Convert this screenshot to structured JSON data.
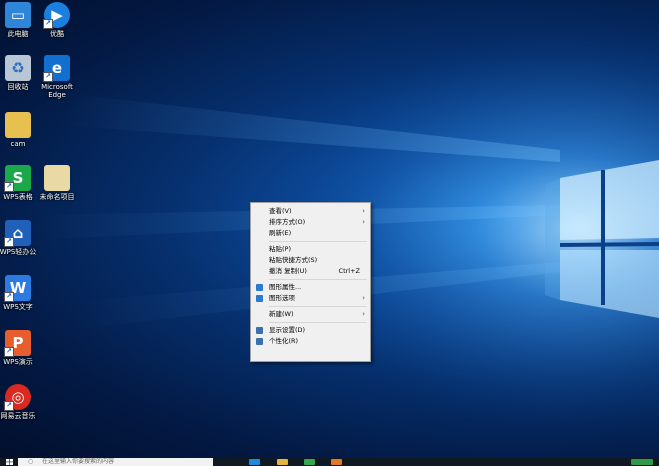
{
  "desktop": {
    "icons": [
      {
        "label": "此电脑",
        "icon": "this-pc-icon",
        "color": "#2f86d8",
        "glyph": "▭"
      },
      {
        "label": "优酷",
        "icon": "youku-icon",
        "color": "#1b7fe0",
        "glyph": "▶"
      },
      {
        "label": "回收站",
        "icon": "recycle-bin-icon",
        "color": "#b8c6d6",
        "glyph": "♻"
      },
      {
        "label": "Microsoft Edge",
        "icon": "edge-icon",
        "color": "#1170cf",
        "glyph": "e"
      },
      {
        "label": "cam",
        "icon": "folder-icon",
        "color": "#e8c050",
        "glyph": ""
      },
      {
        "label": "WPS表格",
        "icon": "wps-spreadsheet-icon",
        "color": "#1ba84a",
        "glyph": "S"
      },
      {
        "label": "未命名项目",
        "icon": "file-icon",
        "color": "#e9d9a4",
        "glyph": ""
      },
      {
        "label": "WPS轻办公",
        "icon": "wps-light-office-icon",
        "color": "#2060b8",
        "glyph": "⌂"
      },
      {
        "label": "WPS文字",
        "icon": "wps-writer-icon",
        "color": "#2d7be0",
        "glyph": "W"
      },
      {
        "label": "WPS演示",
        "icon": "wps-presentation-icon",
        "color": "#e85d2e",
        "glyph": "P"
      },
      {
        "label": "网易云音乐",
        "icon": "netease-music-icon",
        "color": "#d82a20",
        "glyph": "◎"
      }
    ]
  },
  "context_menu": {
    "items": [
      {
        "label": "查看(V)",
        "submenu": true
      },
      {
        "label": "排序方式(O)",
        "submenu": true
      },
      {
        "label": "刷新(E)"
      },
      {
        "separator": true
      },
      {
        "label": "粘贴(P)"
      },
      {
        "label": "粘贴快捷方式(S)"
      },
      {
        "label": "撤消 复制(U)",
        "shortcut": "Ctrl+Z"
      },
      {
        "separator": true
      },
      {
        "label": "图形属性...",
        "icon": "graphics-properties-icon",
        "icon_color": "#2a7bd0"
      },
      {
        "label": "图形选项",
        "icon": "graphics-options-icon",
        "icon_color": "#2a7bd0",
        "submenu": true
      },
      {
        "separator": true
      },
      {
        "label": "新建(W)",
        "submenu": true
      },
      {
        "separator": true
      },
      {
        "label": "显示设置(D)",
        "icon": "display-settings-icon",
        "icon_color": "#3a6fb0"
      },
      {
        "label": "个性化(R)",
        "icon": "personalize-icon",
        "icon_color": "#3a6fb0"
      }
    ]
  },
  "taskbar": {
    "search_placeholder": "在这里输入你要搜索的内容",
    "colors": {
      "bar": "#101822",
      "search": "#f2f2f2",
      "tray": "#2f9a48"
    },
    "apps": [
      {
        "icon": "edge-taskbar-icon",
        "color": "#1c8ae0"
      },
      {
        "icon": "file-explorer-taskbar-icon",
        "color": "#e4b640"
      },
      {
        "icon": "wps-taskbar-icon",
        "color": "#36a852"
      },
      {
        "icon": "app-taskbar-icon",
        "color": "#e07a2a"
      }
    ]
  }
}
